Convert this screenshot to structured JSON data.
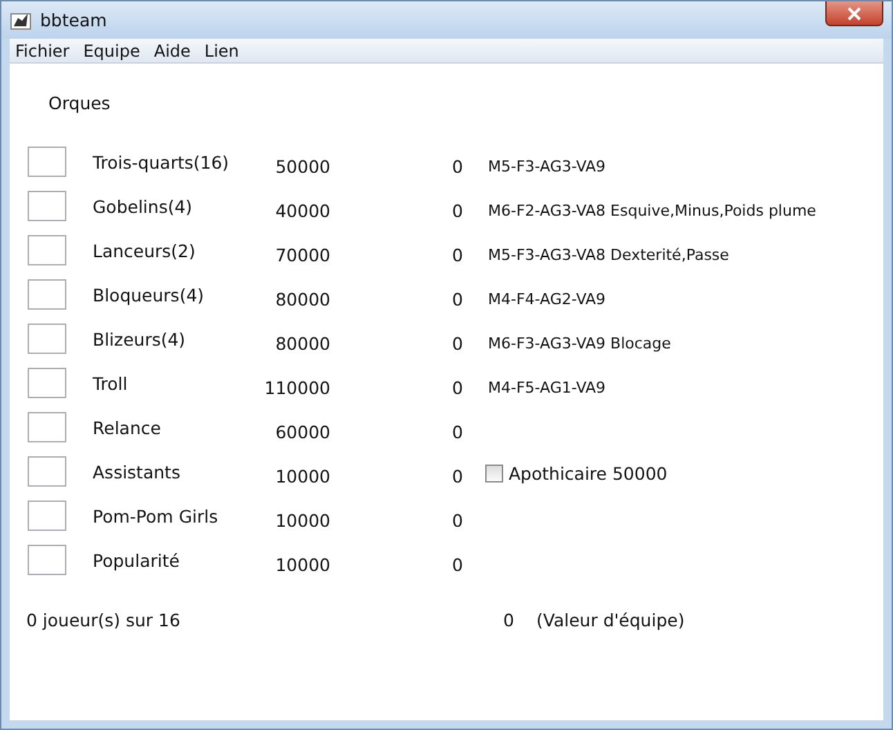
{
  "window": {
    "title": "bbteam"
  },
  "menu": [
    "Fichier",
    "Equipe",
    "Aide",
    "Lien"
  ],
  "team": "Orques",
  "rows": [
    {
      "name": "Trois-quarts(16)",
      "price": "50000",
      "count": "0",
      "desc": "M5-F3-AG3-VA9"
    },
    {
      "name": "Gobelins(4)",
      "price": "40000",
      "count": "0",
      "desc": "M6-F2-AG3-VA8 Esquive,Minus,Poids plume"
    },
    {
      "name": "Lanceurs(2)",
      "price": "70000",
      "count": "0",
      "desc": "M5-F3-AG3-VA8 Dexterité,Passe"
    },
    {
      "name": "Bloqueurs(4)",
      "price": "80000",
      "count": "0",
      "desc": "M4-F4-AG2-VA9"
    },
    {
      "name": "Blizeurs(4)",
      "price": "80000",
      "count": "0",
      "desc": "M6-F3-AG3-VA9 Blocage"
    },
    {
      "name": "Troll",
      "price": "110000",
      "count": "0",
      "desc": "M4-F5-AG1-VA9"
    },
    {
      "name": "Relance",
      "price": "60000",
      "count": "0"
    },
    {
      "name": "Assistants",
      "price": "10000",
      "count": "0",
      "option": {
        "label": "Apothicaire 50000",
        "checked": false
      }
    },
    {
      "name": "Pom-Pom Girls",
      "price": "10000",
      "count": "0"
    },
    {
      "name": "Popularité",
      "price": "10000",
      "count": "0"
    }
  ],
  "footer": {
    "players": "0 joueur(s) sur 16",
    "value": "0",
    "value_label": "(Valeur d'équipe)"
  }
}
